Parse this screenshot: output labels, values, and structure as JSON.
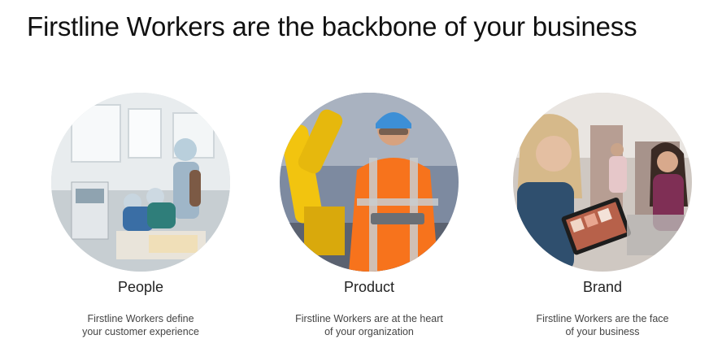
{
  "title": "Firstline Workers are the backbone of your business",
  "cards": [
    {
      "photo_icon": "healthcare-team-photo",
      "title": "People",
      "desc_line1": "Firstline Workers define",
      "desc_line2": "your customer experience"
    },
    {
      "photo_icon": "factory-worker-photo",
      "title": "Product",
      "desc_line1": "Firstline Workers are at the heart",
      "desc_line2": "of your organization"
    },
    {
      "photo_icon": "retail-store-photo",
      "title": "Brand",
      "desc_line1": "Firstline Workers are the face",
      "desc_line2": "of your business"
    }
  ],
  "colors": {
    "safety_orange": "#f7731c",
    "robot_yellow": "#f2c40f",
    "scrubs_blue": "#9fb6c8"
  }
}
